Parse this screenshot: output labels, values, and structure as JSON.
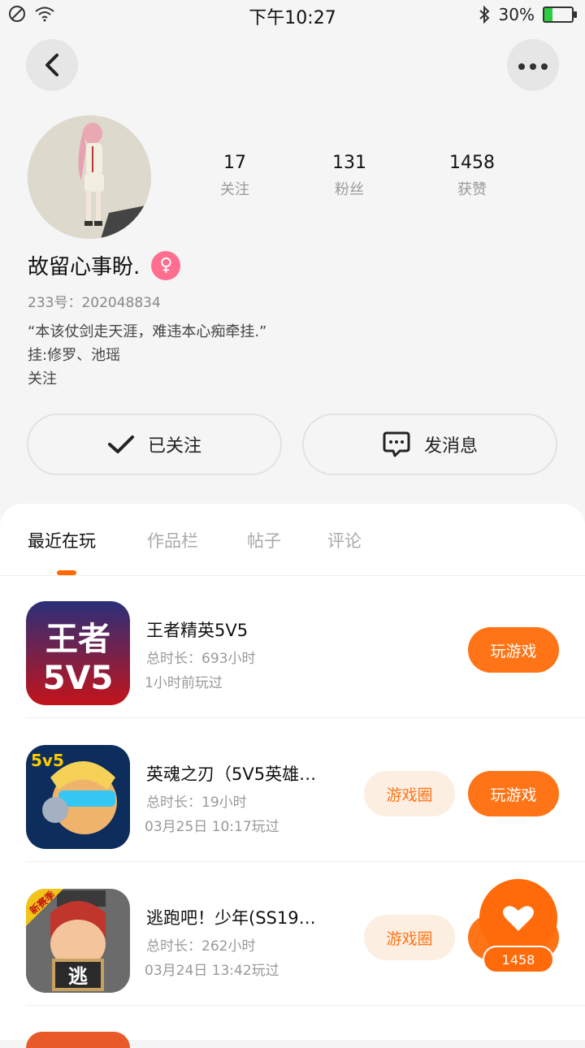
{
  "status_bar": {
    "time": "下午10:27",
    "battery": "30%",
    "battery_level": 0.3
  },
  "profile": {
    "stats": [
      {
        "value": "17",
        "label": "关注"
      },
      {
        "value": "131",
        "label": "粉丝"
      },
      {
        "value": "1458",
        "label": "获赞"
      }
    ],
    "name": "故留心事盼.",
    "gender_symbol": "♀",
    "id_line": "233号：202048834",
    "bio": "“本该仗剑走天涯，难违本心痴牵挂.”\n挂:修罗、池瑶\n关注"
  },
  "actions": {
    "follow_label": "已关注",
    "message_label": "发消息"
  },
  "tabs": [
    "最近在玩",
    "作品栏",
    "帖子",
    "评论"
  ],
  "games": [
    {
      "name": "王者精英5V5",
      "total": "总时长：693小时",
      "last": "1小时前玩过",
      "play_label": "玩游戏",
      "circle_label": ""
    },
    {
      "name": "英魂之刃（5V5英雄…",
      "total": "总时长：19小时",
      "last": "03月25日 10:17玩过",
      "play_label": "玩游戏",
      "circle_label": "游戏圈"
    },
    {
      "name": "逃跑吧！少年(SS19…",
      "total": "总时长：262小时",
      "last": "03月24日 13:42玩过",
      "play_label": "玩游戏",
      "circle_label": "游戏圈"
    }
  ],
  "game_icon_text": {
    "game1": "王者\n5V5",
    "game2_badge": "5v5",
    "game3_badge": "新赛季",
    "game3_sign": "逃"
  },
  "fab": {
    "count": "1458"
  },
  "colors": {
    "accent": "#ff7417",
    "circle_bg": "#fdeee2",
    "gender": "#ff6e8e"
  }
}
